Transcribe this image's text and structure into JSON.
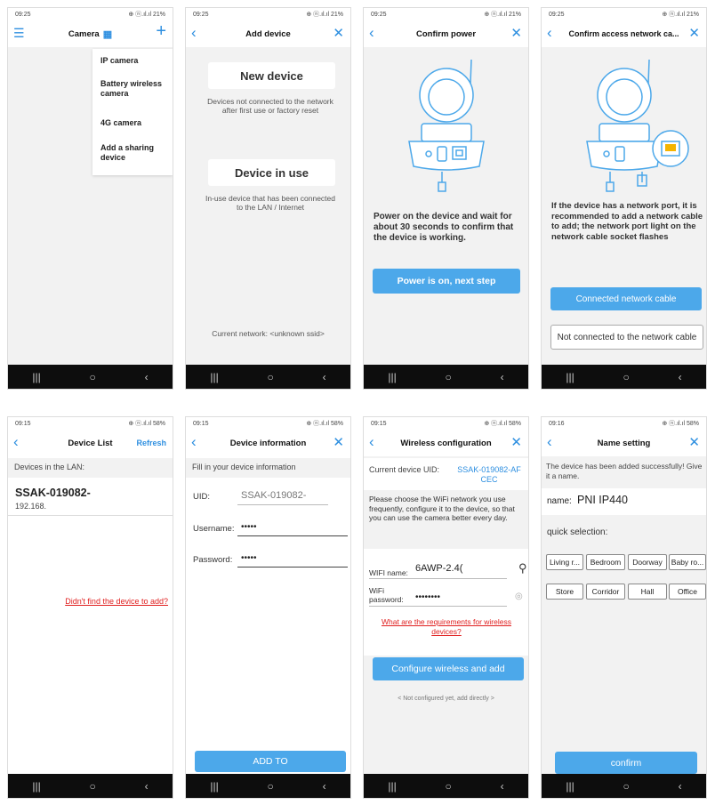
{
  "nav": {
    "recent": "|||",
    "home": "○",
    "back": "‹"
  },
  "s1": {
    "status_time": "09:25",
    "status_right": "⊕ ⓝ.ıl.ıl 21%",
    "title": "Camera",
    "menu": [
      "IP camera",
      "Battery wireless camera",
      "4G camera",
      "Add a sharing device"
    ]
  },
  "s2": {
    "status_time": "09:25",
    "status_right": "⊕ ⓝ.ıl.ıl 21%",
    "title": "Add device",
    "new_device": "New device",
    "new_desc": "Devices not connected to the network after first use or factory reset",
    "in_use": "Device in use",
    "in_use_desc": "In-use device that has been connected to the LAN / Internet",
    "network": "Current network: <unknown ssid>"
  },
  "s3": {
    "status_time": "09:25",
    "status_right": "⊕ ⓝ.ıl.ıl 21%",
    "title": "Confirm power",
    "instruction": "Power on the device and wait for about 30 seconds to confirm that the device is working.",
    "button": "Power is on, next step"
  },
  "s4": {
    "status_time": "09:25",
    "status_right": "⊕ ⓝ.ıl.ıl 21%",
    "title": "Confirm access network ca...",
    "instruction": "If the device has a network port, it is recommended to add a network cable to add; the network port light on the network cable socket flashes",
    "btn_connected": "Connected network cable",
    "btn_not_connected": "Not connected to the network cable"
  },
  "s5": {
    "status_time": "09:15",
    "status_right": "⊕ ⓝ.ıl.ıl 58%",
    "title": "Device List",
    "refresh": "Refresh",
    "section": "Devices in the LAN:",
    "device_name": "SSAK-019082-",
    "device_ip": "192.168.",
    "not_found": "Didn't find the device to add?"
  },
  "s6": {
    "status_time": "09:15",
    "status_right": "⊕ ⓝ.ıl.ıl 58%",
    "title": "Device information",
    "fill": "Fill in your device information",
    "uid_label": "UID:",
    "uid_value": "SSAK-019082-",
    "username_label": "Username:",
    "username_value": "•••••",
    "password_label": "Password:",
    "password_value": "•••••",
    "button": "ADD TO"
  },
  "s7": {
    "status_time": "09:15",
    "status_right": "⊕ ⓝ.ıl.ıl 58%",
    "title": "Wireless configuration",
    "uid_label": "Current device UID:",
    "uid_value": "SSAK-019082-AF CEC",
    "desc": "Please choose the WiFi network you use frequently, configure it to the device, so that you can use the camera better every day.",
    "wifi_label": "WIFI name:",
    "wifi_value": "6AWP-2.4(",
    "pwd_label": "WiFi password:",
    "pwd_value": "••••••••",
    "requirements": "What are the requirements for wireless devices?",
    "button": "Configure wireless and add",
    "skip": "< Not configured yet, add directly >"
  },
  "s8": {
    "status_time": "09:16",
    "status_right": "⊕ ⓝ.ıl.ıl 58%",
    "title": "Name setting",
    "desc": "The device has been added successfully! Give it a name.",
    "name_label": "name:",
    "name_value": "PNI IP440",
    "quick": "quick selection:",
    "chips": [
      "Living r...",
      "Bedroom",
      "Doorway",
      "Baby ro...",
      "Store",
      "Corridor",
      "Hall",
      "Office"
    ],
    "button": "confirm"
  },
  "colors": {
    "accent": "#2e8fe0",
    "button": "#4ca8ea",
    "link_red": "#e02020",
    "navbar": "#0d0d0d"
  }
}
